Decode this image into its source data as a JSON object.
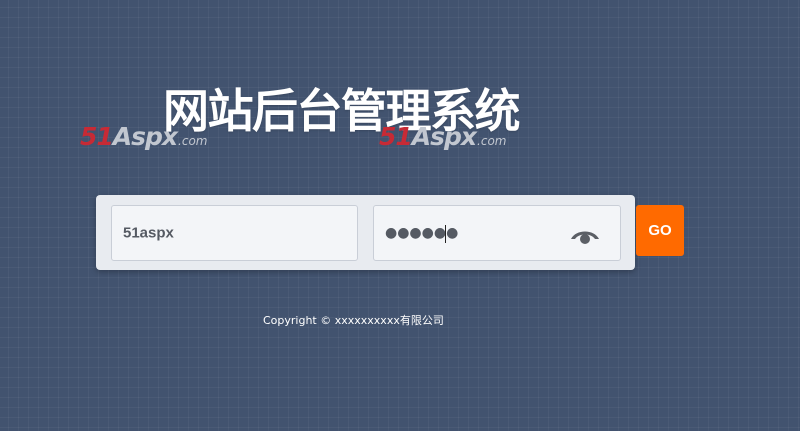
{
  "page": {
    "title": "网站后台管理系统"
  },
  "watermark": {
    "number": "51",
    "word": "Aspx",
    "domain": ".com"
  },
  "login": {
    "username_value": "51aspx",
    "password_display": "●●●●●●",
    "password_length": 6,
    "submit_label": "GO"
  },
  "footer": {
    "copyright": "Copyright © xxxxxxxxxx有限公司"
  },
  "colors": {
    "background": "#42536f",
    "accent": "#ff6a00",
    "watermark_red": "#c72a35"
  },
  "icons": {
    "password_toggle": "eye-icon"
  }
}
